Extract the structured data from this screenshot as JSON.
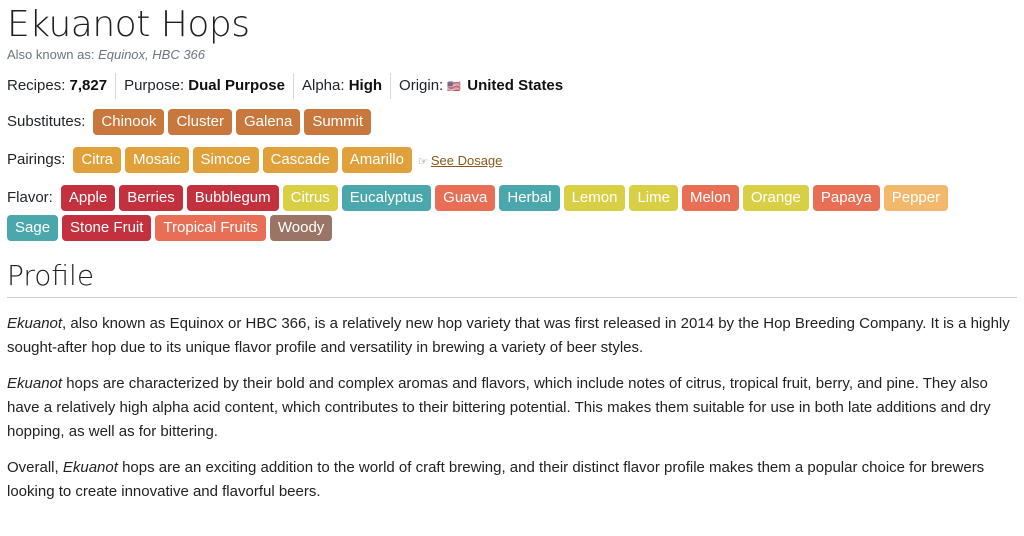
{
  "hop": {
    "name": "Ekuanot Hops",
    "aka_label": "Also known as:",
    "aka_names": "Equinox, HBC 366"
  },
  "stats": {
    "recipes_label": "Recipes:",
    "recipes_value": "7,827",
    "purpose_label": "Purpose:",
    "purpose_value": "Dual Purpose",
    "alpha_label": "Alpha:",
    "alpha_value": "High",
    "origin_label": "Origin:",
    "origin_flag": "🇺🇸",
    "origin_value": "United States"
  },
  "substitutes": {
    "label": "Substitutes:",
    "items": [
      "Chinook",
      "Cluster",
      "Galena",
      "Summit"
    ]
  },
  "pairings": {
    "label": "Pairings:",
    "items": [
      "Citra",
      "Mosaic",
      "Simcoe",
      "Cascade",
      "Amarillo"
    ],
    "dosage_icon": "pointing-hand-icon",
    "dosage_link": "See Dosage"
  },
  "flavor": {
    "label": "Flavor:",
    "items": [
      {
        "name": "Apple",
        "color": "#c3303e"
      },
      {
        "name": "Berries",
        "color": "#c3303e"
      },
      {
        "name": "Bubblegum",
        "color": "#c3303e"
      },
      {
        "name": "Citrus",
        "color": "#d8cf45"
      },
      {
        "name": "Eucalyptus",
        "color": "#4aa8ad"
      },
      {
        "name": "Guava",
        "color": "#e86f55"
      },
      {
        "name": "Herbal",
        "color": "#4aa8ad"
      },
      {
        "name": "Lemon",
        "color": "#d8cf45"
      },
      {
        "name": "Lime",
        "color": "#d8cf45"
      },
      {
        "name": "Melon",
        "color": "#e86f55"
      },
      {
        "name": "Orange",
        "color": "#d8cf45"
      },
      {
        "name": "Papaya",
        "color": "#e86f55"
      },
      {
        "name": "Pepper",
        "color": "#f2b86b"
      },
      {
        "name": "Sage",
        "color": "#4aa8ad"
      },
      {
        "name": "Stone Fruit",
        "color": "#c3303e"
      },
      {
        "name": "Tropical Fruits",
        "color": "#e86f55"
      },
      {
        "name": "Woody",
        "color": "#9a7464"
      }
    ]
  },
  "colors": {
    "substitute_tag": "#c8783c",
    "pairing_tag": "#e0a13a"
  },
  "profile": {
    "heading": "Profile",
    "p1_name": "Ekuanot",
    "p1_text": ", also known as Equinox or HBC 366, is a relatively new hop variety that was first released in 2014 by the Hop Breeding Company. It is a highly sought-after hop due to its unique flavor profile and versatility in brewing a variety of beer styles.",
    "p2_name": "Ekuanot",
    "p2_text": " hops are characterized by their bold and complex aromas and flavors, which include notes of citrus, tropical fruit, berry, and pine. They also have a relatively high alpha acid content, which contributes to their bittering potential. This makes them suitable for use in both late additions and dry hopping, as well as for bittering.",
    "p3_pre": "Overall, ",
    "p3_name": "Ekuanot",
    "p3_text": " hops are an exciting addition to the world of craft brewing, and their distinct flavor profile makes them a popular choice for brewers looking to create innovative and flavorful beers."
  }
}
